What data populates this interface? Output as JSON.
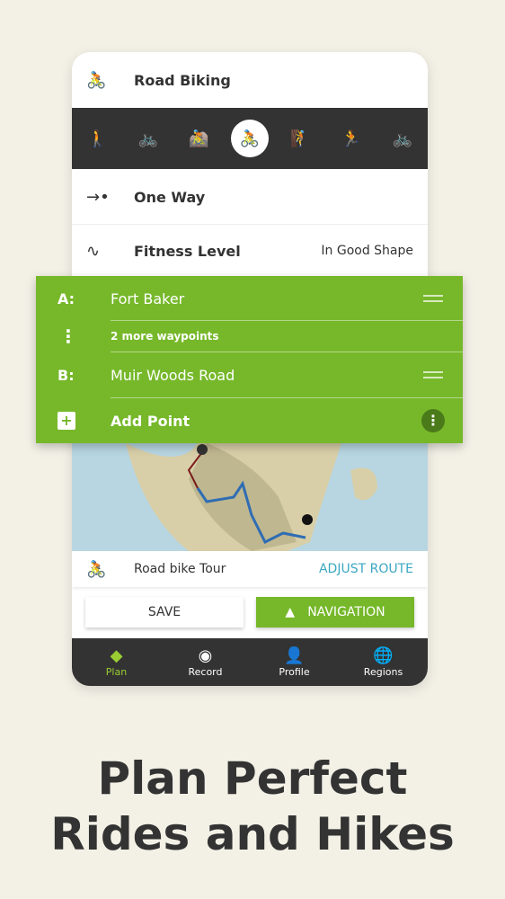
{
  "header": {
    "activity_icon": "road-bike-icon",
    "activity": "Road Biking"
  },
  "activities": [
    {
      "icon": "hiking-icon",
      "glyph": "🚶",
      "selected": false
    },
    {
      "icon": "bike-icon",
      "glyph": "🚲",
      "selected": false
    },
    {
      "icon": "mountain-bike-icon",
      "glyph": "🚵",
      "selected": false
    },
    {
      "icon": "road-bike-icon",
      "glyph": "🚴",
      "selected": true
    },
    {
      "icon": "climbing-icon",
      "glyph": "🧗",
      "selected": false
    },
    {
      "icon": "running-icon",
      "glyph": "🏃",
      "selected": false
    },
    {
      "icon": "touring-bike-icon",
      "glyph": "🚲",
      "selected": false
    }
  ],
  "route_type": {
    "label": "One Way"
  },
  "fitness": {
    "label": "Fitness Level",
    "value": "In Good Shape"
  },
  "waypoints": {
    "a_key": "A:",
    "a": "Fort Baker",
    "more": "2 more waypoints",
    "b_key": "B:",
    "b": "Muir Woods Road",
    "add": "Add Point"
  },
  "tour": {
    "label": "Road bike Tour",
    "adjust": "ADJUST ROUTE"
  },
  "buttons": {
    "save": "SAVE",
    "navigation": "NAVIGATION"
  },
  "nav": [
    {
      "label": "Plan",
      "active": true
    },
    {
      "label": "Record"
    },
    {
      "label": "Profile"
    },
    {
      "label": "Regions"
    }
  ],
  "headline": {
    "line1": "Plan Perfect",
    "line2": "Rides and Hikes"
  },
  "colors": {
    "accent": "#76b82a",
    "dark": "#333333",
    "link": "#3aa8c1",
    "background": "#f3f1e6"
  }
}
